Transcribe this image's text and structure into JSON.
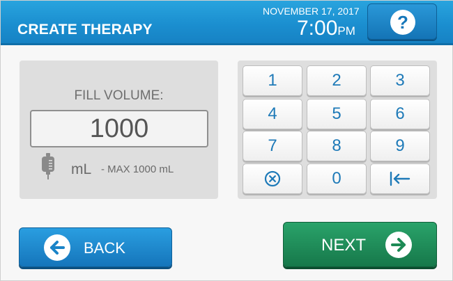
{
  "header": {
    "title": "CREATE THERAPY",
    "date": "NOVEMBER 17, 2017",
    "time": "7:00",
    "ampm": "PM",
    "help_symbol": "?"
  },
  "fill_panel": {
    "label": "FILL VOLUME:",
    "value": "1000",
    "unit": "mL",
    "max_text": "- MAX 1000 mL",
    "icon": "iv-bag-icon"
  },
  "keypad": {
    "keys": [
      "1",
      "2",
      "3",
      "4",
      "5",
      "6",
      "7",
      "8",
      "9",
      "",
      "0",
      ""
    ],
    "clear_icon": "clear-icon",
    "backspace_icon": "backspace-icon"
  },
  "buttons": {
    "back_label": "BACK",
    "next_label": "NEXT"
  },
  "colors": {
    "header_blue": "#1b8fd0",
    "key_text": "#1e7ab8",
    "next_green": "#1f8c58",
    "panel_gray": "#dedede"
  }
}
